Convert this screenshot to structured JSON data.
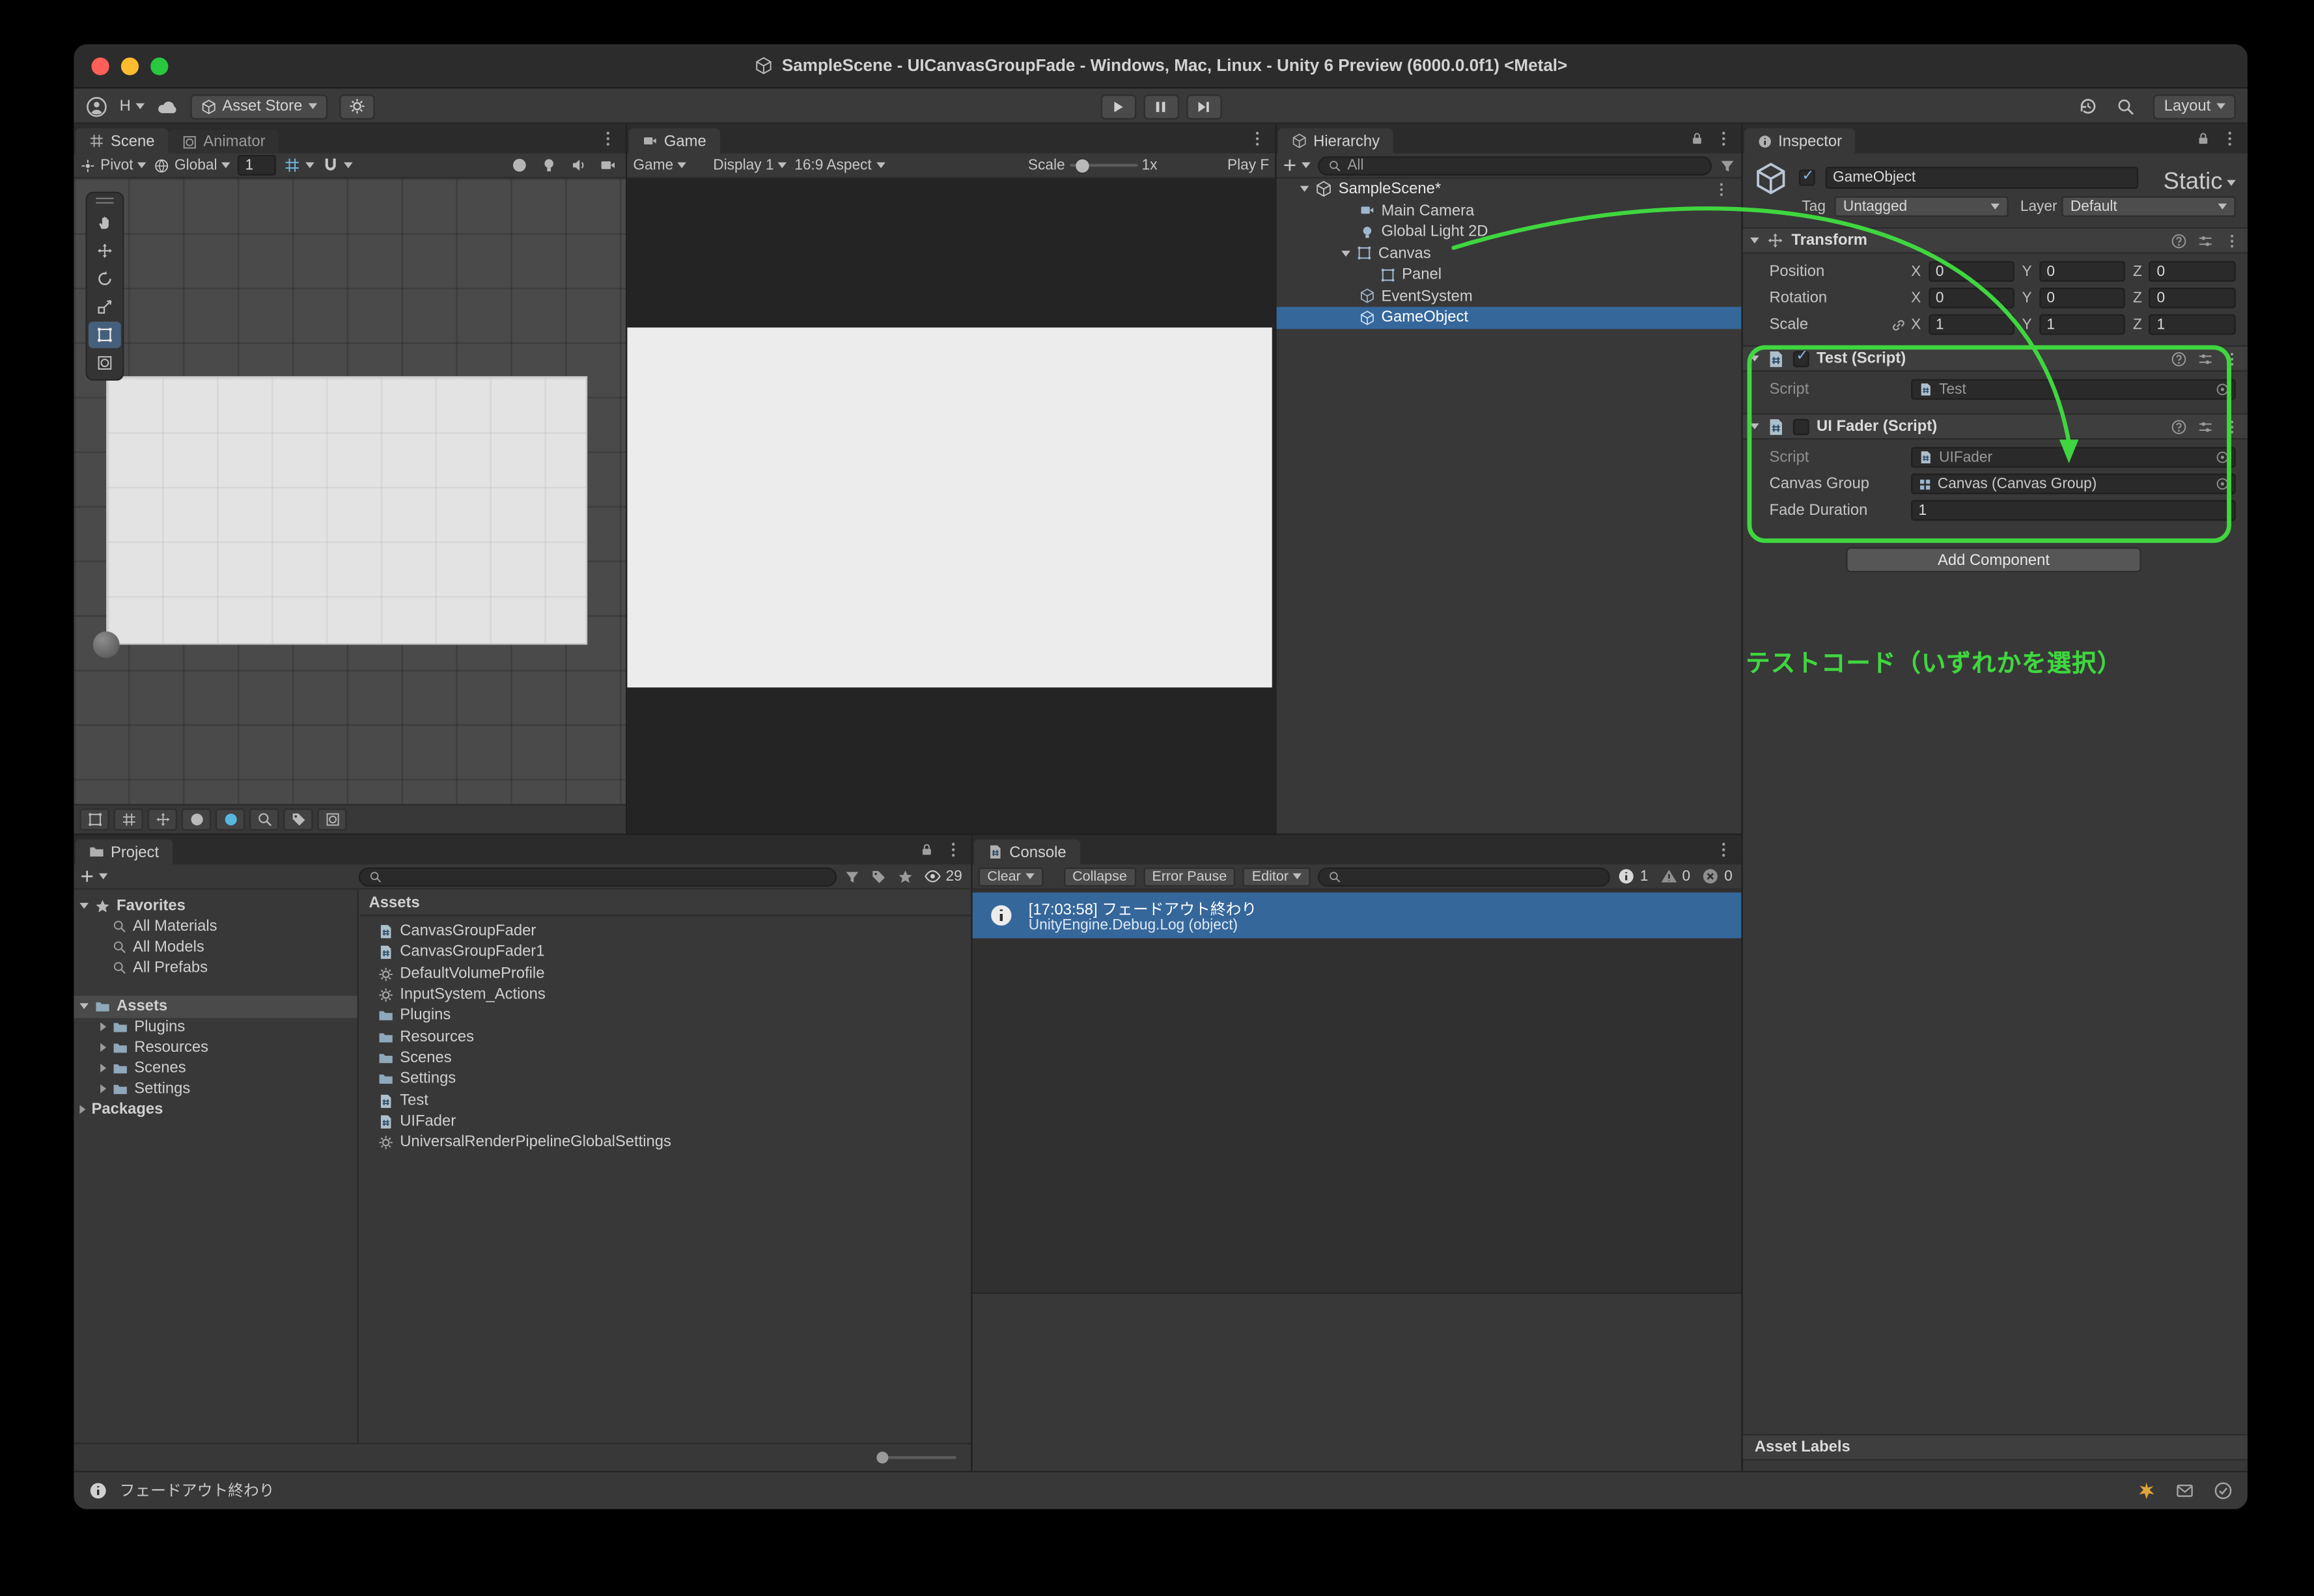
{
  "colors": {
    "accent_green": "#3fd63f",
    "selection_blue": "#35679b"
  },
  "window": {
    "title": "SampleScene - UICanvasGroupFade - Windows, Mac, Linux - Unity 6 Preview (6000.0.0f1) <Metal>"
  },
  "topbar": {
    "account": "H",
    "asset_store": "Asset Store",
    "layout": "Layout"
  },
  "scene": {
    "tab": "Scene",
    "tab_animator": "Animator",
    "pivot": "Pivot",
    "global": "Global",
    "grid_value": "1"
  },
  "game": {
    "tab": "Game",
    "menu": "Game",
    "display": "Display 1",
    "aspect": "16:9 Aspect",
    "scale_label": "Scale",
    "scale_value": "1x",
    "play_focused": "Play F"
  },
  "hierarchy": {
    "tab": "Hierarchy",
    "search_filter": "All",
    "items": [
      {
        "label": "SampleScene*"
      },
      {
        "label": "Main Camera"
      },
      {
        "label": "Global Light 2D"
      },
      {
        "label": "Canvas"
      },
      {
        "label": "Panel"
      },
      {
        "label": "EventSystem"
      },
      {
        "label": "GameObject"
      }
    ]
  },
  "inspector": {
    "tab": "Inspector",
    "name": "GameObject",
    "static_label": "Static",
    "tag_label": "Tag",
    "tag_value": "Untagged",
    "layer_label": "Layer",
    "layer_value": "Default",
    "transform": {
      "title": "Transform",
      "axis": [
        "X",
        "Y",
        "Z"
      ],
      "rows": [
        {
          "label": "Position",
          "x": "0",
          "y": "0",
          "z": "0"
        },
        {
          "label": "Rotation",
          "x": "0",
          "y": "0",
          "z": "0"
        },
        {
          "label": "Scale",
          "x": "1",
          "y": "1",
          "z": "1"
        }
      ]
    },
    "components": [
      {
        "title": "Test (Script)",
        "fields": [
          {
            "label": "Script",
            "value": "Test"
          }
        ]
      },
      {
        "title": "UI Fader (Script)",
        "fields": [
          {
            "label": "Script",
            "value": "UIFader"
          },
          {
            "label": "Canvas Group",
            "value": "Canvas (Canvas Group)"
          },
          {
            "label": "Fade Duration",
            "value": "1"
          }
        ]
      }
    ],
    "add_component": "Add Component",
    "annotation": "テストコード（いずれかを選択）",
    "asset_labels": "Asset Labels"
  },
  "project": {
    "tab": "Project",
    "favorites_label": "Favorites",
    "favorites": [
      "All Materials",
      "All Models",
      "All Prefabs"
    ],
    "assets_root": "Assets",
    "folders": [
      "Plugins",
      "Resources",
      "Scenes",
      "Settings"
    ],
    "packages_label": "Packages",
    "list_header": "Assets",
    "hidden_count": "29",
    "files": [
      {
        "name": "CanvasGroupFader",
        "type": "script"
      },
      {
        "name": "CanvasGroupFader1",
        "type": "script"
      },
      {
        "name": "DefaultVolumeProfile",
        "type": "asset"
      },
      {
        "name": "InputSystem_Actions",
        "type": "asset"
      },
      {
        "name": "Plugins",
        "type": "folder"
      },
      {
        "name": "Resources",
        "type": "folder"
      },
      {
        "name": "Scenes",
        "type": "folder"
      },
      {
        "name": "Settings",
        "type": "folder"
      },
      {
        "name": "Test",
        "type": "script"
      },
      {
        "name": "UIFader",
        "type": "script"
      },
      {
        "name": "UniversalRenderPipelineGlobalSettings",
        "type": "asset"
      }
    ]
  },
  "console": {
    "tab": "Console",
    "clear": "Clear",
    "collapse": "Collapse",
    "error_pause": "Error Pause",
    "editor": "Editor",
    "info_count": "1",
    "warn_count": "0",
    "error_count": "0",
    "entry": {
      "line1": "[17:03:58] フェードアウト終わり",
      "line2": "UnityEngine.Debug.Log (object)"
    }
  },
  "statusbar": {
    "message": "フェードアウト終わり"
  }
}
